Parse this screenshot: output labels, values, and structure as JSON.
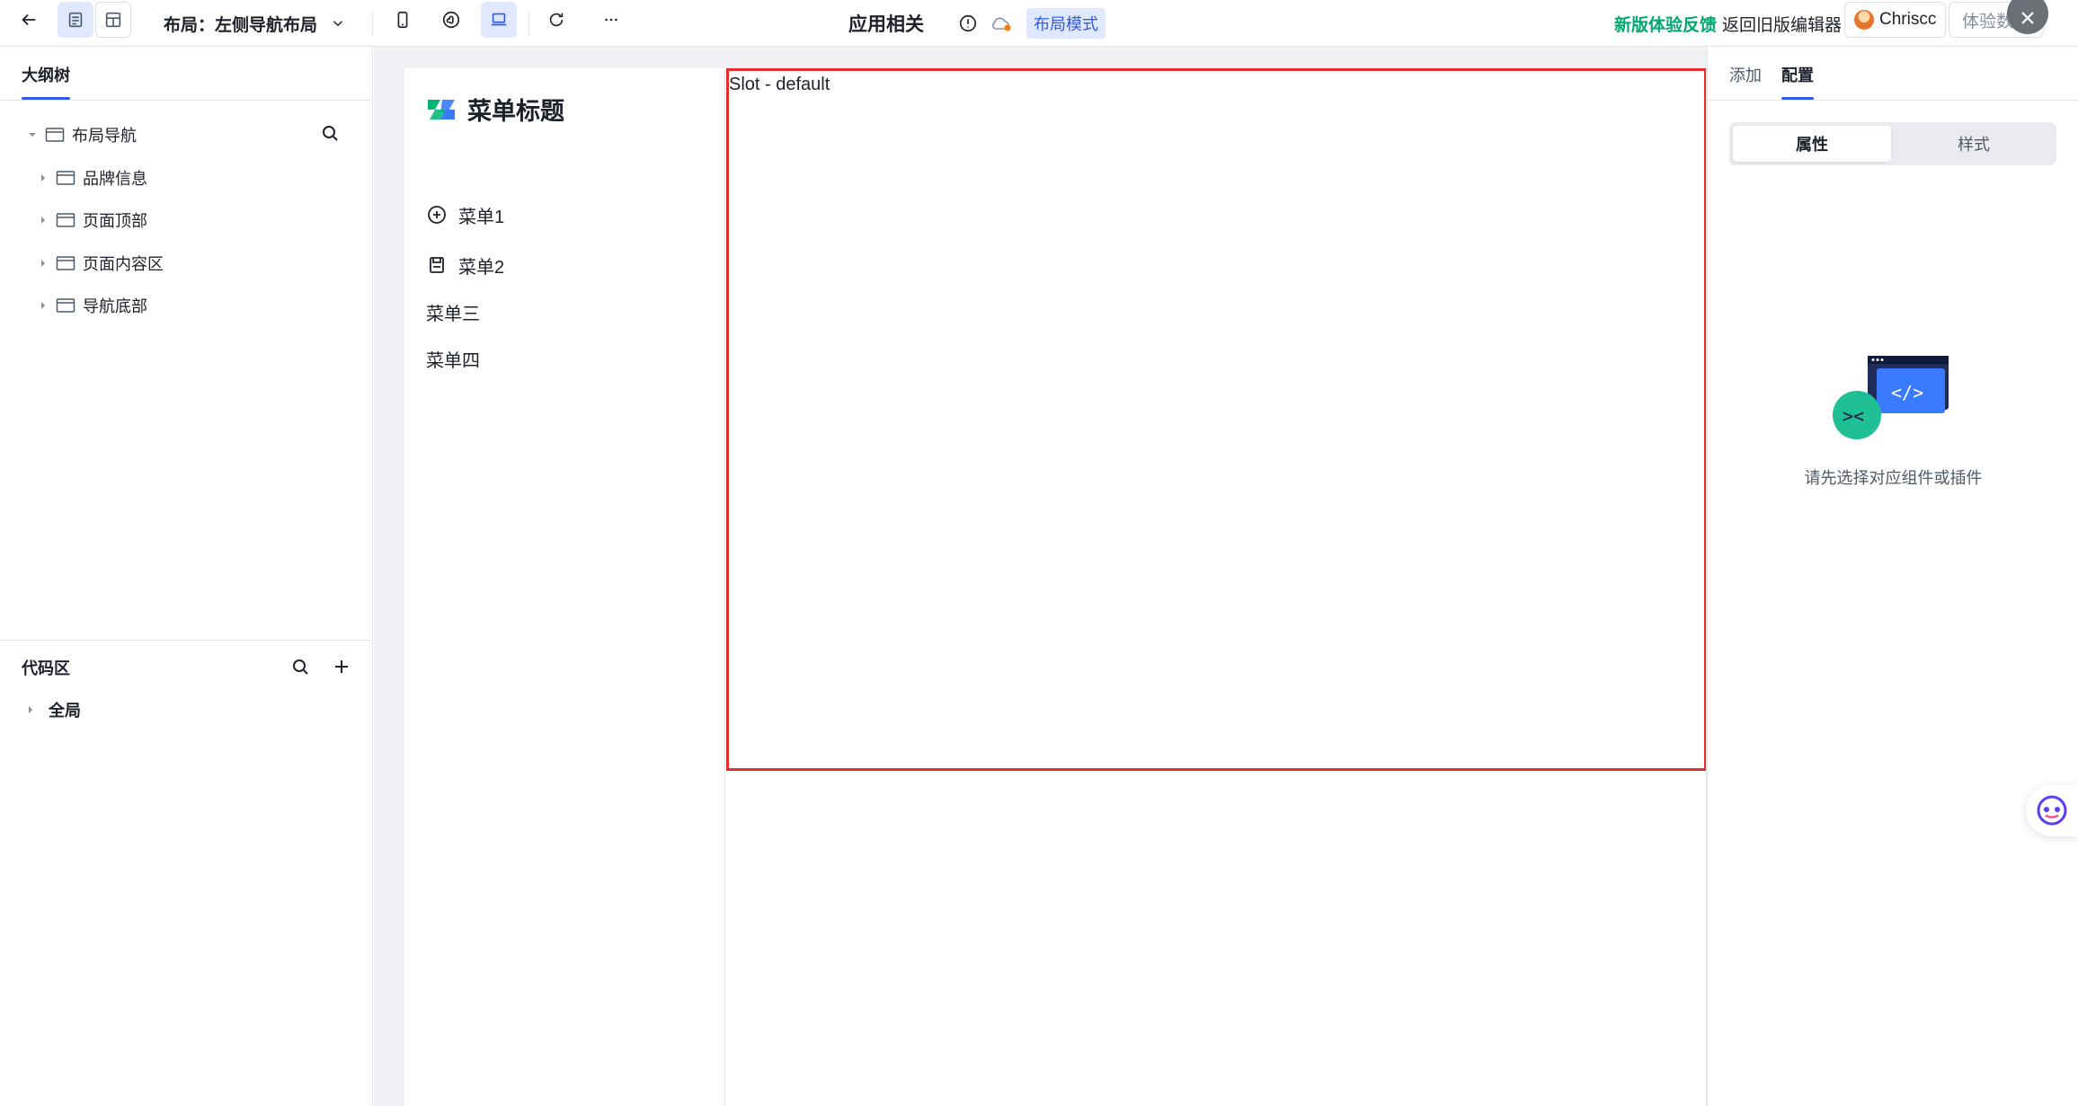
{
  "topbar": {
    "layout_label": "布局：左侧导航布局",
    "app_title": "应用相关",
    "mode_badge": "布局模式",
    "feedback": "新版体验反馈",
    "old_editor": "返回旧版编辑器",
    "user_name": "Chriscc",
    "trial_button": "体验数据"
  },
  "left_panel": {
    "tab": "大纲树",
    "tree": [
      {
        "label": "布局导航",
        "level": 0,
        "expanded": true
      },
      {
        "label": "品牌信息",
        "level": 1,
        "expanded": false
      },
      {
        "label": "页面顶部",
        "level": 1,
        "expanded": false
      },
      {
        "label": "页面内容区",
        "level": 1,
        "expanded": false
      },
      {
        "label": "导航底部",
        "level": 1,
        "expanded": false
      }
    ],
    "code_title": "代码区",
    "code_global": "全局"
  },
  "canvas": {
    "brand_title": "菜单标题",
    "menu": [
      "菜单1",
      "菜单2",
      "菜单三",
      "菜单四"
    ],
    "slot_label": "Slot - default"
  },
  "right_panel": {
    "tabs": [
      "添加",
      "配置"
    ],
    "active_tab": "配置",
    "segments": [
      "属性",
      "样式"
    ],
    "active_segment": "属性",
    "empty_text": "请先选择对应组件或插件"
  },
  "colors": {
    "accent": "#2f5bea",
    "feedback_green": "#00a870",
    "slot_border": "#e62d2d",
    "brand_green": "#00b578",
    "brand_blue": "#3a7afe"
  }
}
